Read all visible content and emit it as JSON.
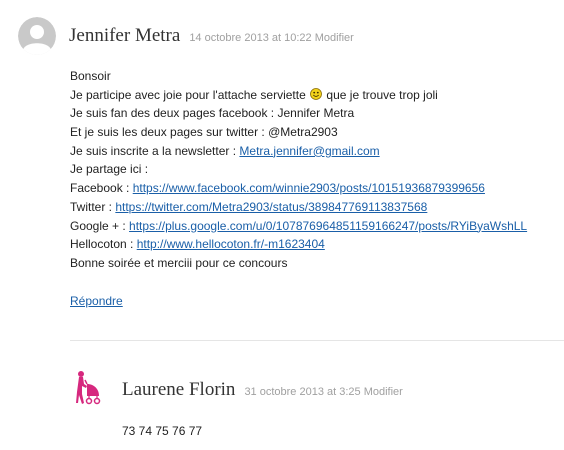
{
  "comments": [
    {
      "author": "Jennifer Metra",
      "date": "14 octobre 2013 at 10:22",
      "edit_label": "Modifier",
      "avatar_icon": "default-user-avatar-icon",
      "lines": [
        {
          "text": "Bonsoir"
        },
        {
          "before": "Je participe avec joie pour l'attache serviette ",
          "icon": "smiley-face-icon",
          "after": " que je trouve trop joli"
        },
        {
          "text": "Je suis fan des deux pages facebook : Jennifer Metra"
        },
        {
          "text": "Et je suis les deux pages sur twitter : @Metra2903"
        },
        {
          "before": "Je suis inscrite a la newsletter : ",
          "link": "Metra.jennifer@gmail.com"
        },
        {
          "text": "Je partage ici :"
        },
        {
          "before": "Facebook : ",
          "link": "https://www.facebook.com/winnie2903/posts/10151936879399656"
        },
        {
          "before": "Twitter : ",
          "link": "https://twitter.com/Metra2903/status/389847769113837568"
        },
        {
          "before": "Google + : ",
          "link": "https://plus.google.com/u/0/107876964851159166247/posts/RYiByaWshLL"
        },
        {
          "before": "Hellocoton : ",
          "link": "http://www.hellocoton.fr/-m1623404"
        },
        {
          "text": "Bonne soirée et merciii pour ce concours"
        }
      ],
      "reply_label": "Répondre"
    },
    {
      "author": "Laurene Florin",
      "date": "31 octobre 2013 at 3:25",
      "edit_label": "Modifier",
      "avatar_icon": "pink-stroller-avatar-icon",
      "body": "73 74 75 76 77"
    }
  ],
  "colors": {
    "link": "#1a5fa8",
    "meta": "#a0a0a0",
    "avatar_grey": "#c9c9c9",
    "avatar_pink": "#d6287e",
    "smiley_yellow": "#f2d21b"
  }
}
